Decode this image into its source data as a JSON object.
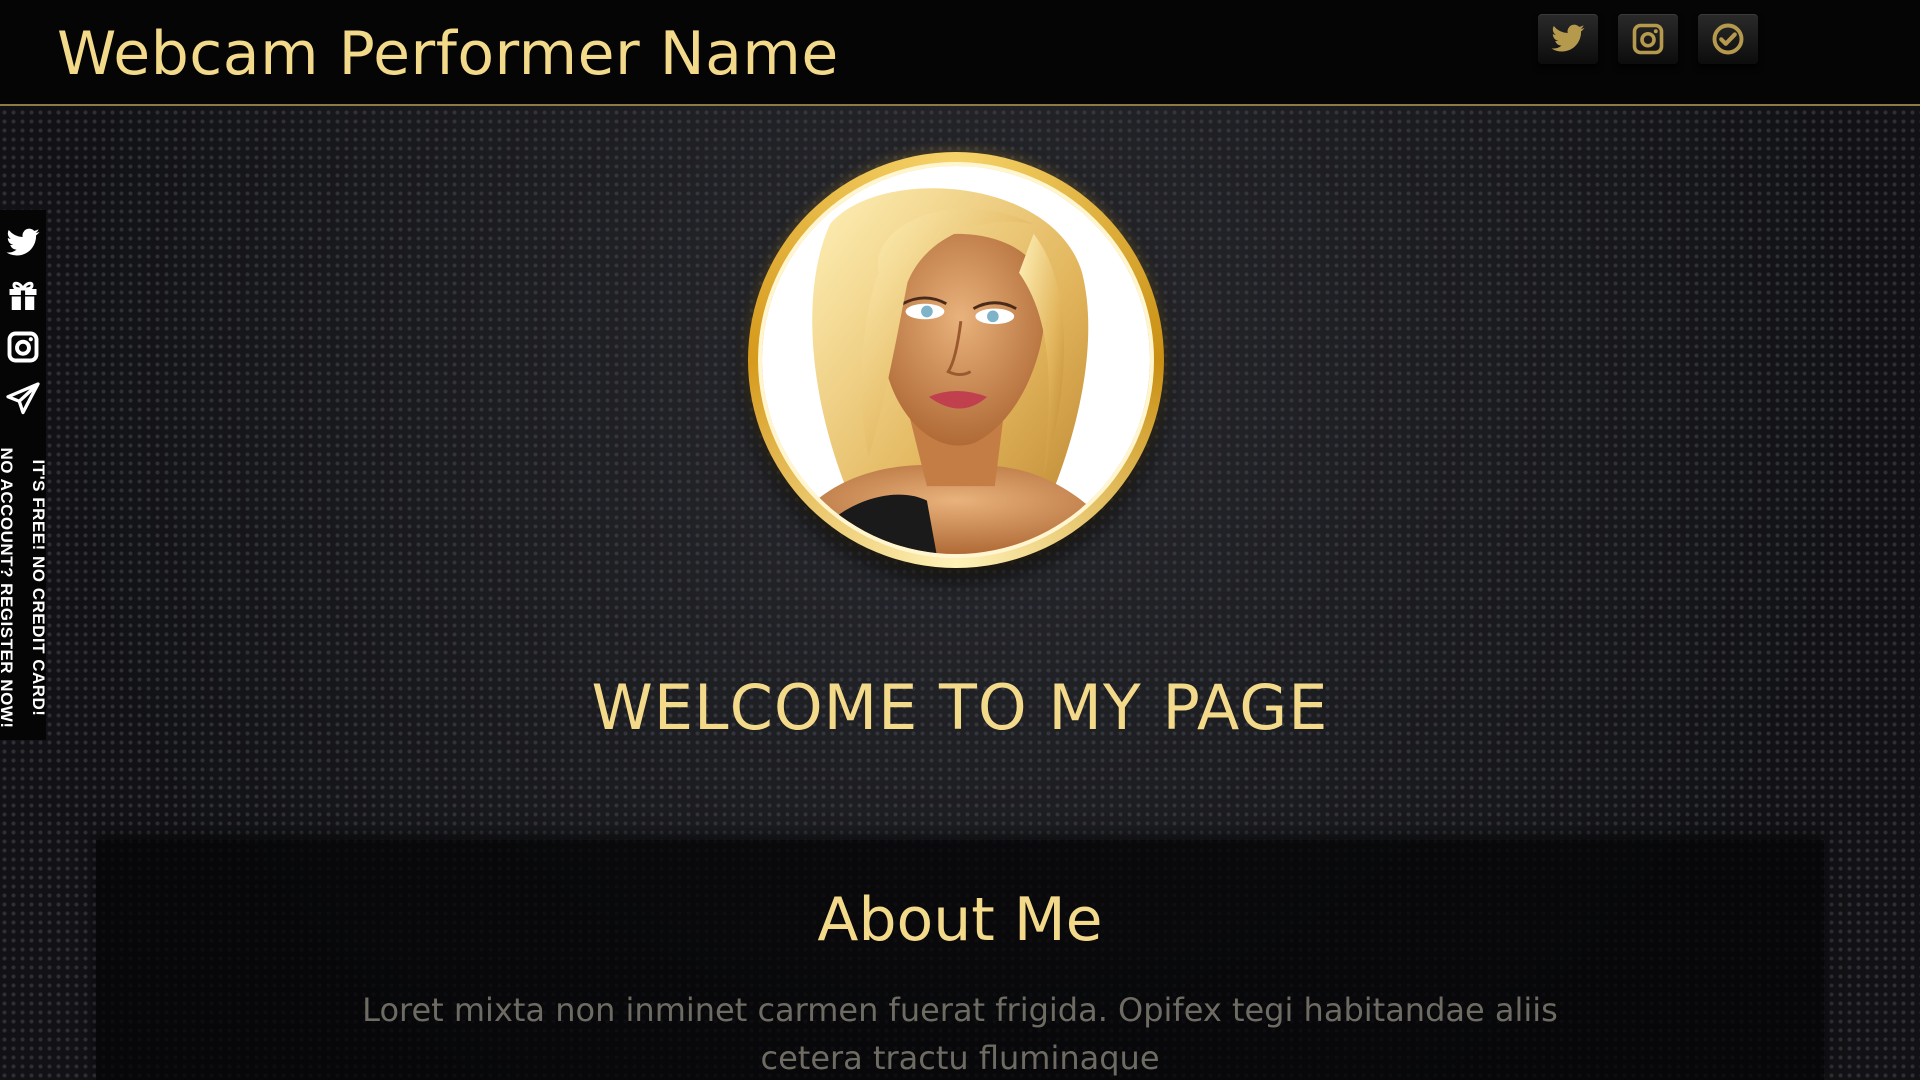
{
  "header": {
    "title": "Webcam Performer Name",
    "icons": [
      {
        "name": "twitter-icon"
      },
      {
        "name": "instagram-icon"
      },
      {
        "name": "verified-check-icon"
      }
    ]
  },
  "sidebar": {
    "icons": [
      {
        "name": "twitter-icon"
      },
      {
        "name": "gift-icon"
      },
      {
        "name": "instagram-icon"
      },
      {
        "name": "send-icon"
      }
    ],
    "vertical_text_line1": "NO ACCOUNT? REGISTER NOW!",
    "vertical_text_line2": "IT'S FREE! NO CREDIT CARD!"
  },
  "hero": {
    "welcome": "WELCOME TO MY PAGE"
  },
  "about": {
    "title": "About Me",
    "body": "Loret mixta non inminet carmen fuerat frigida. Opifex tegi habitandae aliis cetera tractu fluminaque"
  },
  "colors": {
    "accent_gold": "#f3d98a",
    "header_bg": "#050505",
    "body_text": "#6e6b63"
  }
}
